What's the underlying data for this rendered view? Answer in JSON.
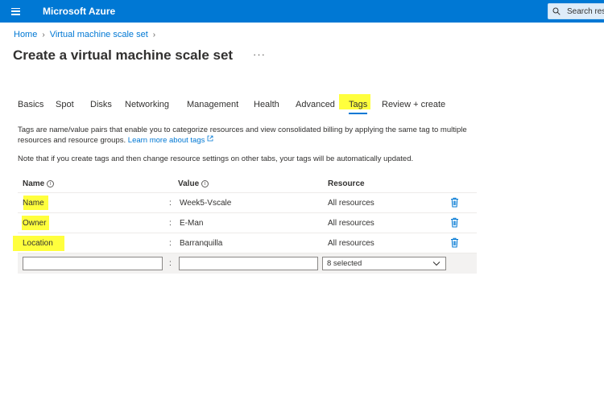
{
  "header": {
    "brand": "Microsoft Azure",
    "search_placeholder": "Search resources, services, and docs (G+/)",
    "search_visible": "Search res"
  },
  "breadcrumb": [
    "Home",
    "Virtual machine scale set"
  ],
  "page": {
    "title": "Create a virtual machine scale set",
    "more": "···"
  },
  "tabs": [
    {
      "label": "Basics"
    },
    {
      "label": "Spot"
    },
    {
      "label": "Disks"
    },
    {
      "label": "Networking"
    },
    {
      "label": "Management"
    },
    {
      "label": "Health"
    },
    {
      "label": "Advanced"
    },
    {
      "label": "Tags",
      "active": true
    },
    {
      "label": "Review + create"
    }
  ],
  "description": {
    "text": "Tags are name/value pairs that enable you to categorize resources and view consolidated billing by applying the same tag to multiple resources and resource groups.",
    "link": "Learn more about tags",
    "note": "Note that if you create tags and then change resource settings on other tabs, your tags will be automatically updated."
  },
  "table": {
    "headers": {
      "name": "Name",
      "value": "Value",
      "resource": "Resource"
    },
    "separator": ":",
    "rows": [
      {
        "name": "Name",
        "value": "Week5-Vscale",
        "resource": "All resources"
      },
      {
        "name": "Owner",
        "value": "E-Man",
        "resource": "All resources"
      },
      {
        "name": "Location",
        "value": "Barranquilla",
        "resource": "All resources"
      }
    ],
    "new_row": {
      "name": "",
      "value": "",
      "resource": "8 selected"
    }
  },
  "colors": {
    "azure_blue": "#0078d4",
    "highlight": "#ffff3d"
  },
  "icons": [
    "hamburger-icon",
    "search-icon",
    "chevron-right-icon",
    "info-icon",
    "external-link-icon",
    "trash-icon",
    "chevron-down-icon"
  ]
}
